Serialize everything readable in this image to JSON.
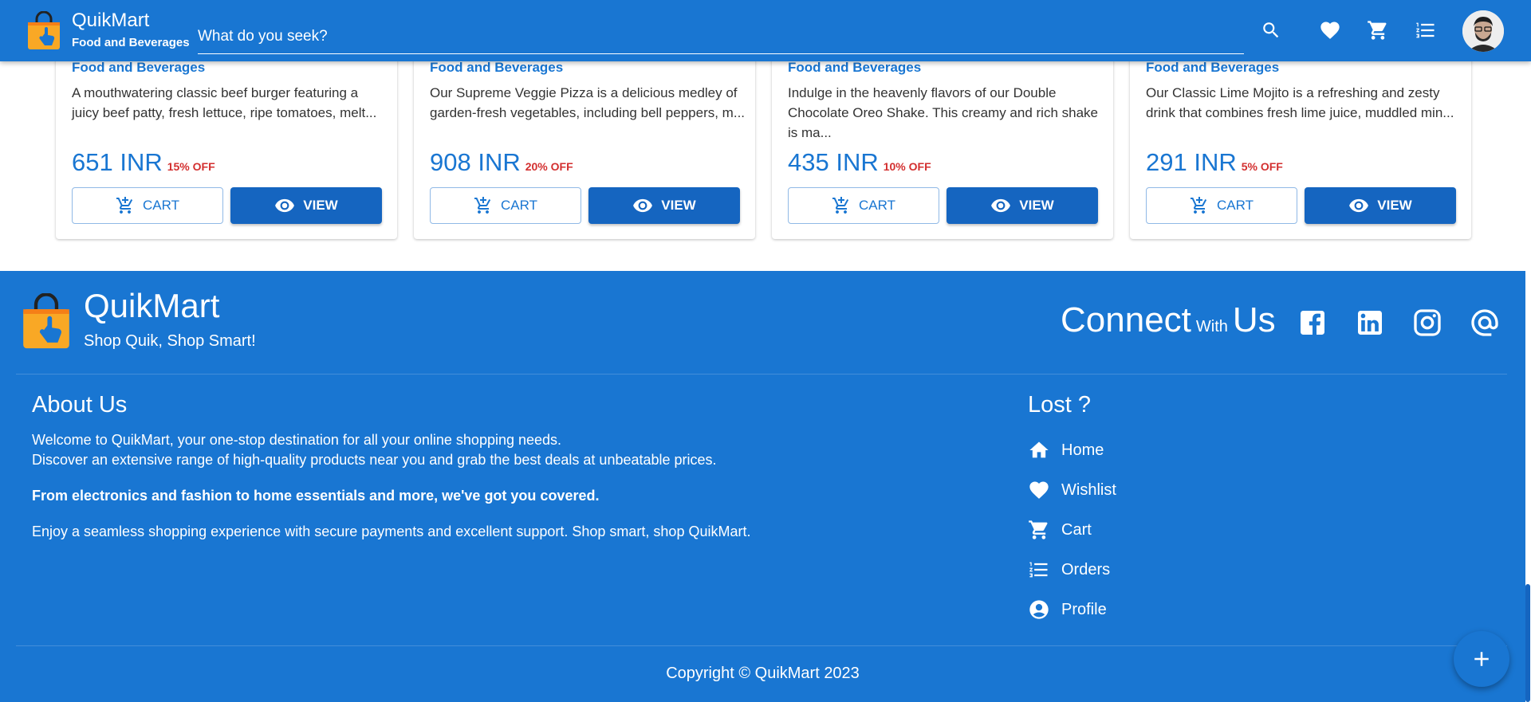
{
  "header": {
    "brand_name": "QuikMart",
    "category": "Food and Beverages",
    "search_placeholder": "What do you seek?",
    "icons": [
      "search-icon",
      "heart-icon",
      "cart-icon",
      "list-icon",
      "avatar"
    ]
  },
  "products": [
    {
      "category": "Food and Beverages",
      "description": "A mouthwatering classic beef burger featuring a juicy beef patty, fresh lettuce, ripe tomatoes, melt...",
      "price": "651 INR",
      "discount": "15% OFF",
      "cart_label": "CART",
      "view_label": "VIEW"
    },
    {
      "category": "Food and Beverages",
      "description": "Our Supreme Veggie Pizza is a delicious medley of garden-fresh vegetables, including bell peppers, m...",
      "price": "908 INR",
      "discount": "20% OFF",
      "cart_label": "CART",
      "view_label": "VIEW"
    },
    {
      "category": "Food and Beverages",
      "description": "Indulge in the heavenly flavors of our Double Chocolate Oreo Shake. This creamy and rich shake is ma...",
      "price": "435 INR",
      "discount": "10% OFF",
      "cart_label": "CART",
      "view_label": "VIEW"
    },
    {
      "category": "Food and Beverages",
      "description": "Our Classic Lime Mojito is a refreshing and zesty drink that combines fresh lime juice, muddled min...",
      "price": "291 INR",
      "discount": "5% OFF",
      "cart_label": "CART",
      "view_label": "VIEW"
    }
  ],
  "footer": {
    "brand_name": "QuikMart",
    "slogan": "Shop Quik, Shop Smart!",
    "connect_big_1": "Connect",
    "connect_small": "With",
    "connect_big_2": "Us",
    "social_icons": [
      "facebook-icon",
      "linkedin-icon",
      "instagram-icon",
      "at-sign-icon"
    ],
    "about_title": "About Us",
    "about_line_1": "Welcome to QuikMart, your one-stop destination for all your online shopping needs.",
    "about_line_2": "Discover an extensive range of high-quality products near you and grab the best deals at unbeatable prices.",
    "about_bold": "From electronics and fashion to home essentials and more, we've got you covered.",
    "about_line_3": "Enjoy a seamless shopping experience with secure payments and excellent support. Shop smart, shop QuikMart.",
    "lost_title": "Lost ?",
    "links": [
      {
        "label": "Home",
        "icon": "home-icon"
      },
      {
        "label": "Wishlist",
        "icon": "heart-icon"
      },
      {
        "label": "Cart",
        "icon": "cart-icon"
      },
      {
        "label": "Orders",
        "icon": "list-icon"
      },
      {
        "label": "Profile",
        "icon": "account-circle-icon"
      }
    ],
    "copyright": "Copyright © QuikMart 2023"
  },
  "fab": {
    "icon": "plus-icon"
  },
  "colors": {
    "primary": "#1976d2",
    "primary_dark": "#1565c0",
    "discount_red": "#d32f2f",
    "logo_orange": "#f9a825"
  }
}
